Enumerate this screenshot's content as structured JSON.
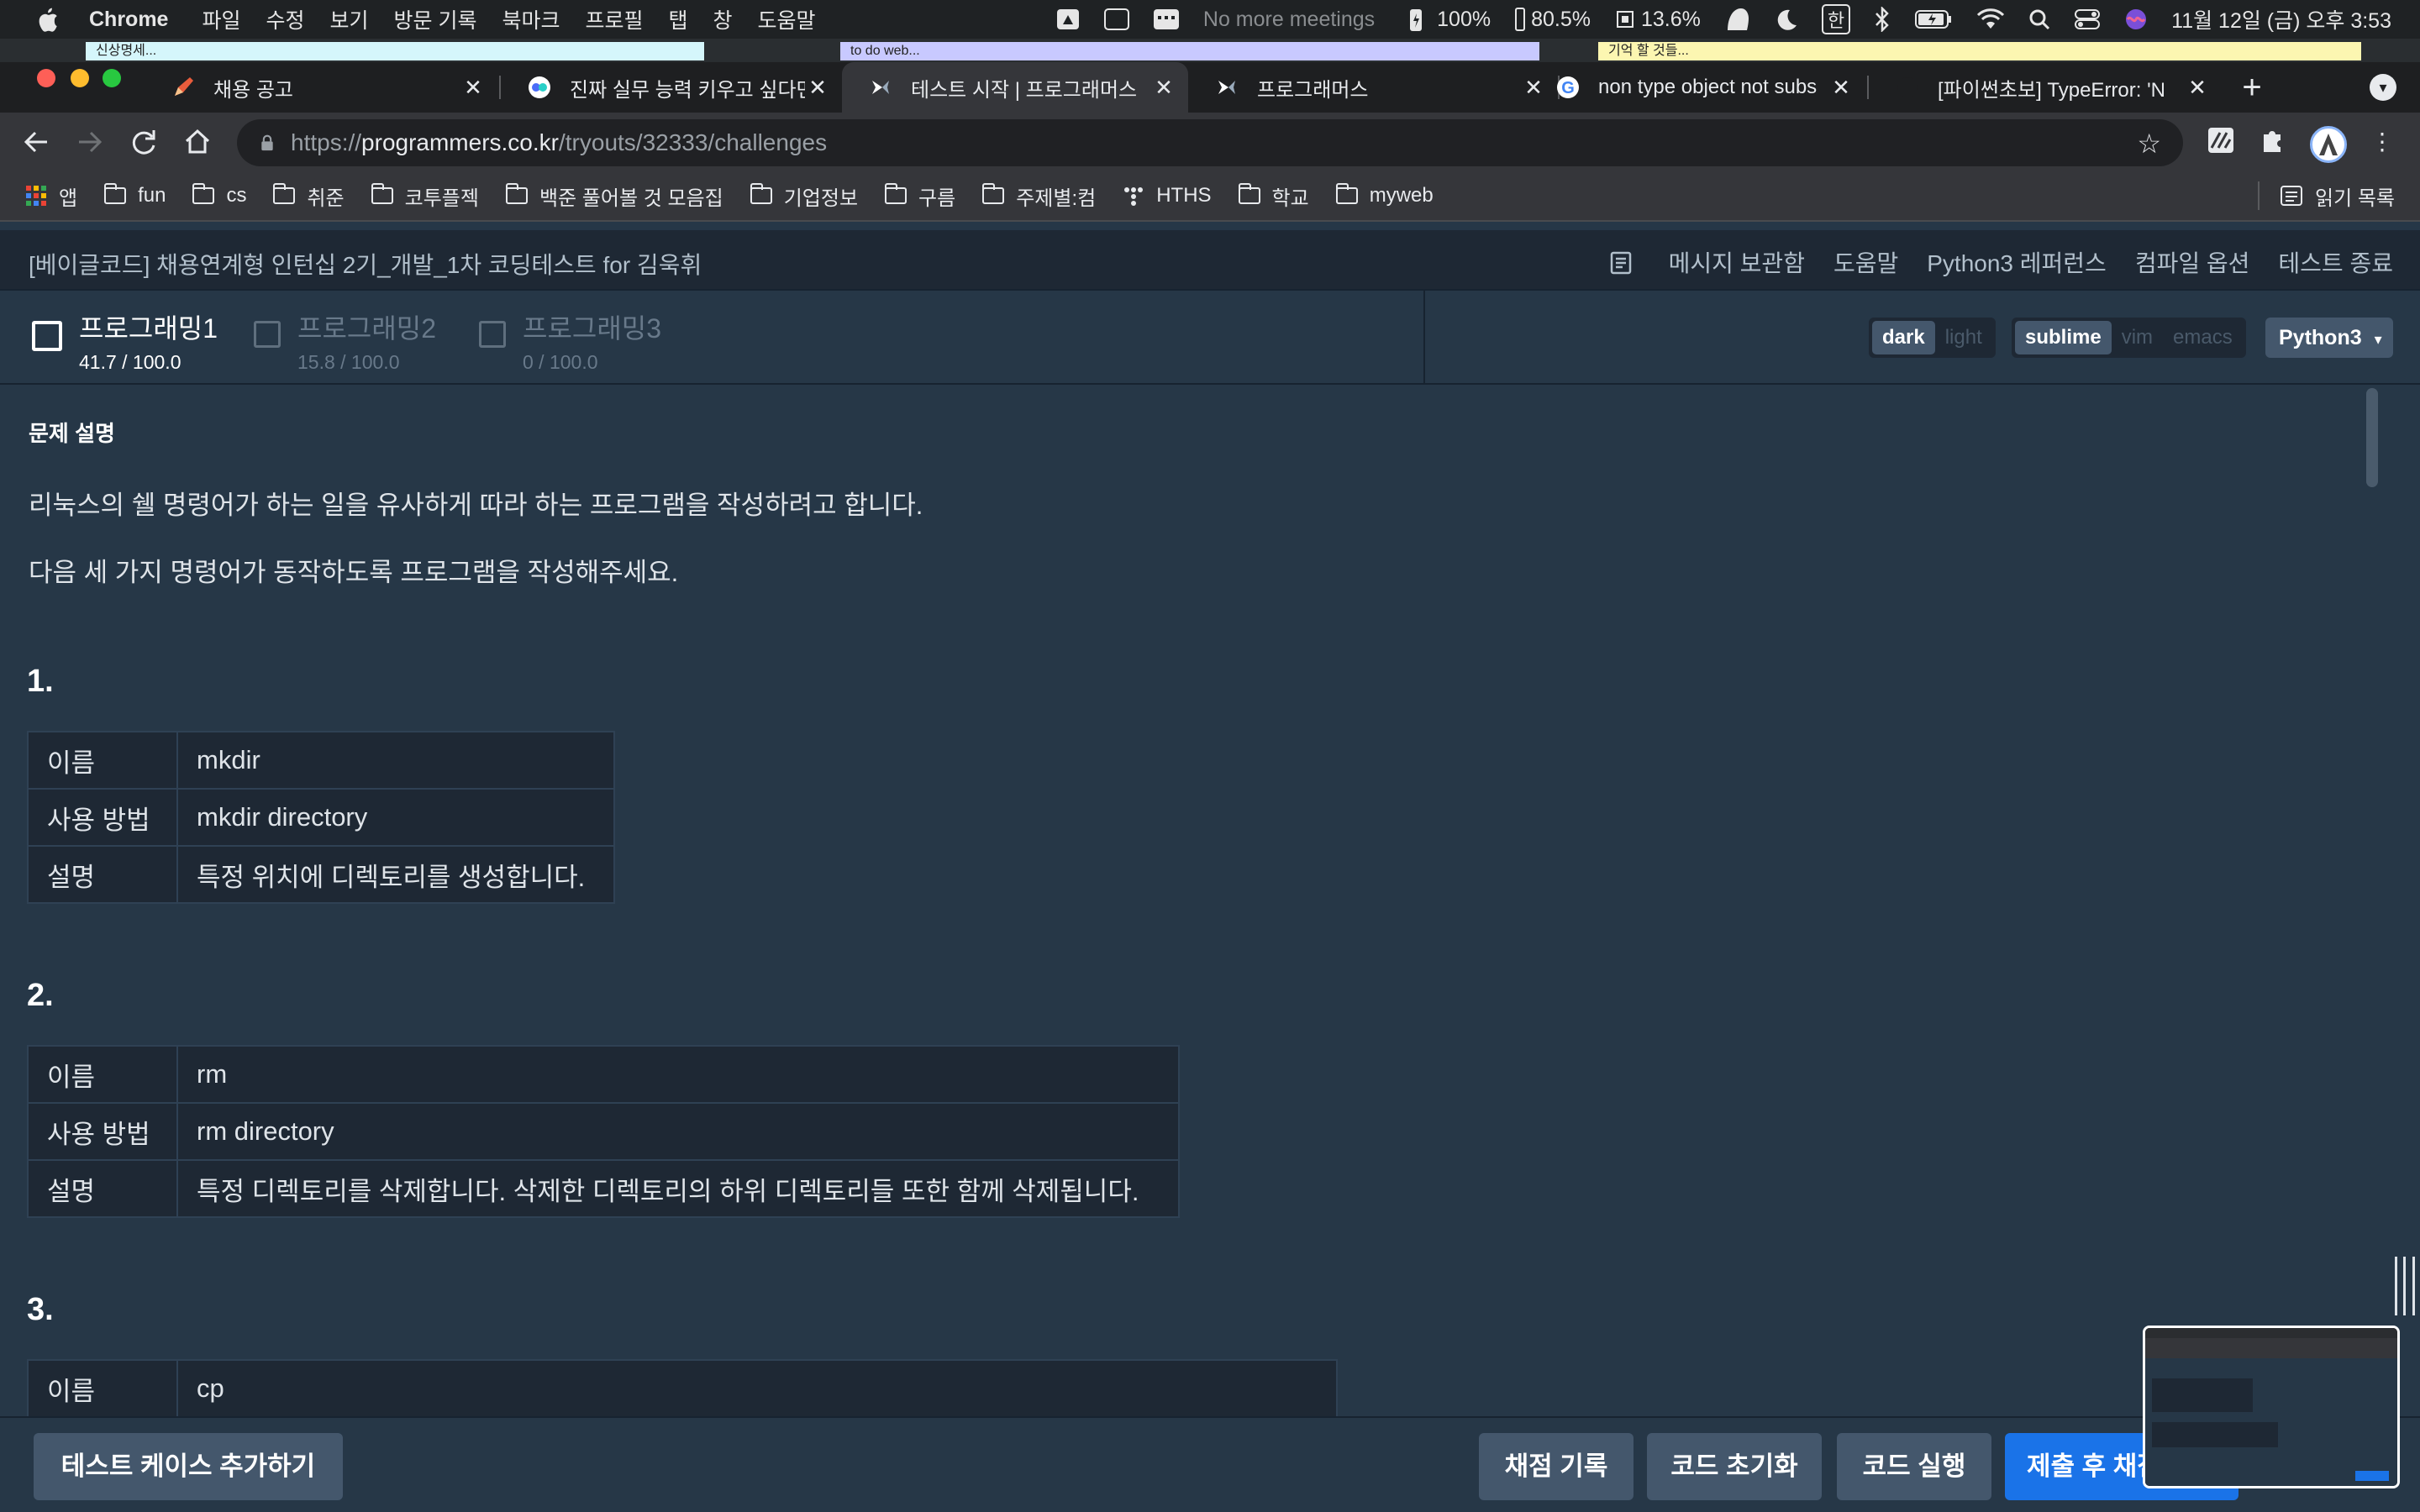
{
  "menubar": {
    "app_name": "Chrome",
    "items": [
      "파일",
      "수정",
      "보기",
      "방문 기록",
      "북마크",
      "프로필",
      "탭",
      "창",
      "도움말"
    ],
    "meeting": "No more meetings",
    "stats": [
      "100%",
      "80.5%",
      "13.6%"
    ],
    "ime": "한",
    "clock": "11월 12일 (금) 오후 3:53"
  },
  "stickies": [
    {
      "text": "신상명세...",
      "color": "#d5f6fb"
    },
    {
      "text": "to do web...",
      "color": "#c8c9ff"
    },
    {
      "text": "기억 할 것들...",
      "color": "#fcf6b1"
    }
  ],
  "tabs": [
    {
      "title": "채용 공고"
    },
    {
      "title": "진짜 실무 능력 키우고 싶다면"
    },
    {
      "title": "테스트 시작 | 프로그래머스"
    },
    {
      "title": "프로그래머스"
    },
    {
      "title": "non type object not subs"
    },
    {
      "title": "[파이썬초보] TypeError: 'N"
    }
  ],
  "url": {
    "scheme": "https://",
    "host": "programmers.co.kr",
    "path": "/tryouts/32333/challenges"
  },
  "bookmarks": {
    "apps": "앱",
    "items": [
      "fun",
      "cs",
      "취준",
      "코투플젝",
      "백준 풀어볼 것 모음집",
      "기업정보",
      "구름",
      "주제별:컴",
      "HTHS",
      "학교",
      "myweb"
    ],
    "reading_list": "읽기 목록"
  },
  "header": {
    "title": "[베이글코드] 채용연계형 인턴십 2기_개발_1차 코딩테스트 for 김욱휘",
    "links": [
      "메시지 보관함",
      "도움말",
      "Python3 레퍼런스",
      "컴파일 옵션",
      "테스트 종료"
    ]
  },
  "problems": [
    {
      "name": "프로그래밍1",
      "score": "41.7 / 100.0"
    },
    {
      "name": "프로그래밍2",
      "score": "15.8 / 100.0"
    },
    {
      "name": "프로그래밍3",
      "score": "0 / 100.0"
    }
  ],
  "editor_options": {
    "themes": [
      "dark",
      "light"
    ],
    "keymaps": [
      "sublime",
      "vim",
      "emacs"
    ],
    "language": "Python3"
  },
  "content": {
    "heading": "문제 설명",
    "para1": "리눅스의 쉘 명령어가 하는 일을 유사하게 따라 하는 프로그램을 작성하려고 합니다.",
    "para2": "다음 세 가지 명령어가 동작하도록 프로그램을 작성해주세요.",
    "labels": {
      "name": "이름",
      "usage": "사용 방법",
      "desc": "설명"
    },
    "commands": [
      {
        "num": "1.",
        "name": "mkdir",
        "usage": "mkdir directory",
        "desc": "특정 위치에 디렉토리를 생성합니다."
      },
      {
        "num": "2.",
        "name": "rm",
        "usage": "rm directory",
        "desc": "특정 디렉토리를 삭제합니다. 삭제한 디렉토리의 하위 디렉토리들 또한 함께 삭제됩니다."
      },
      {
        "num": "3.",
        "name": "cp"
      }
    ]
  },
  "bottom": {
    "add_testcase": "테스트 케이스 추가하기",
    "history": "채점 기록",
    "reset": "코드 초기화",
    "run": "코드 실행",
    "submit": "제출 후 채점하기"
  }
}
